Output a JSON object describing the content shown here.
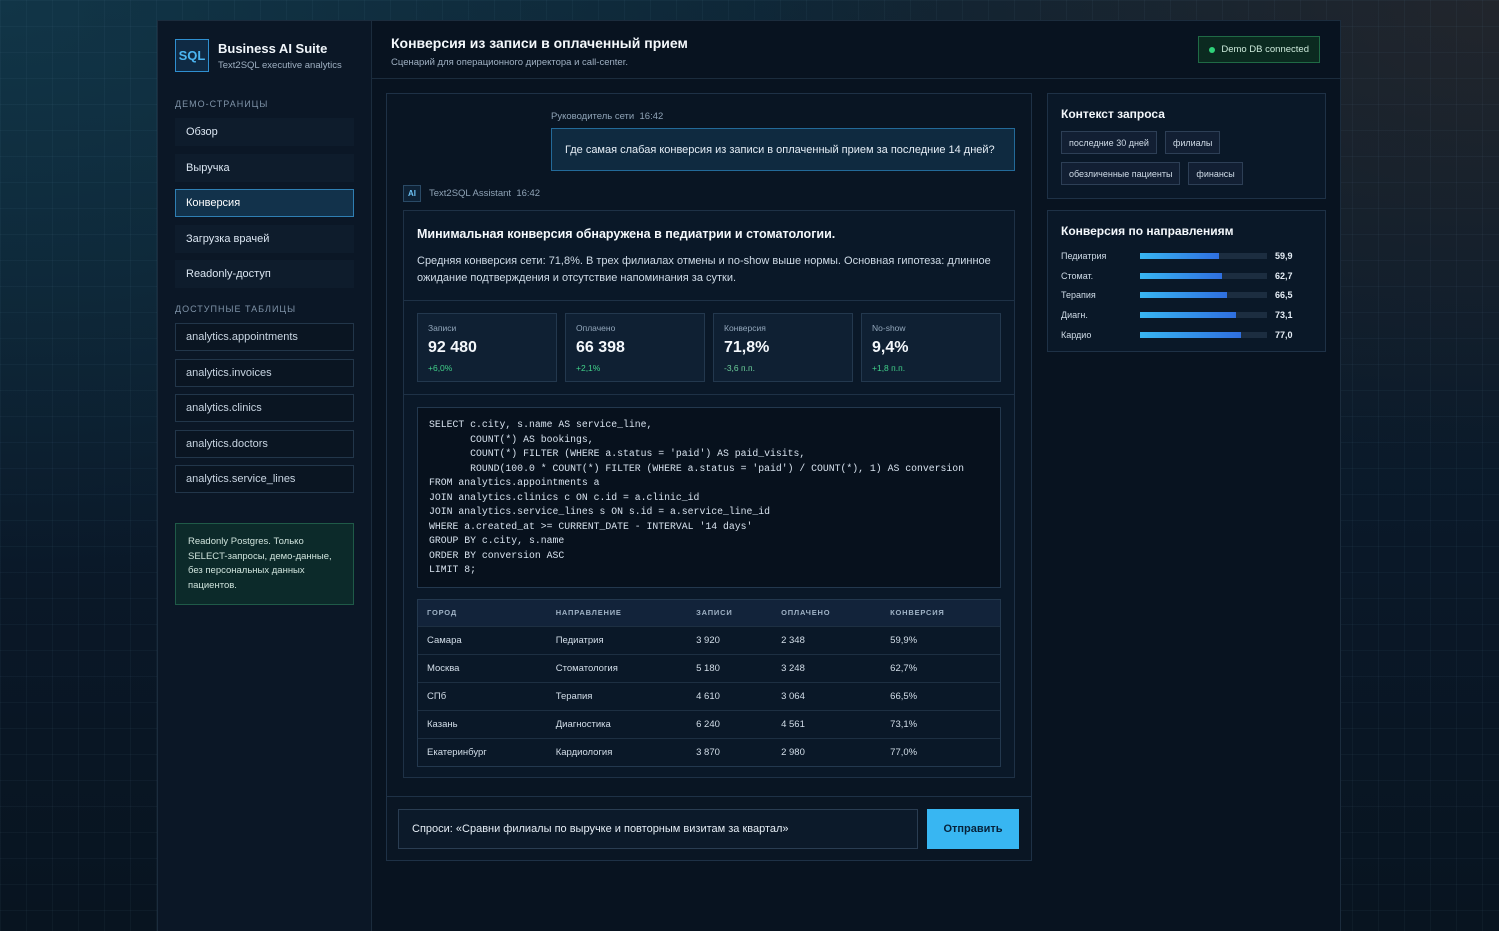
{
  "brand": {
    "logo": "SQL",
    "title": "Business AI Suite",
    "subtitle": "Text2SQL executive analytics"
  },
  "sidebar": {
    "pages_label": "ДЕМО-СТРАНИЦЫ",
    "pages": [
      {
        "label": "Обзор",
        "active": false
      },
      {
        "label": "Выручка",
        "active": false
      },
      {
        "label": "Конверсия",
        "active": true
      },
      {
        "label": "Загрузка врачей",
        "active": false
      },
      {
        "label": "Readonly-доступ",
        "active": false
      }
    ],
    "tables_label": "ДОСТУПНЫЕ ТАБЛИЦЫ",
    "tables": [
      "analytics.appointments",
      "analytics.invoices",
      "analytics.clinics",
      "analytics.doctors",
      "analytics.service_lines"
    ],
    "note": "Readonly Postgres. Только SELECT-запросы, демо-данные, без персональных данных пациентов."
  },
  "header": {
    "title": "Конверсия из записи в оплаченный прием",
    "subtitle": "Сценарий для операционного директора и call-center.",
    "status": "Demo DB connected"
  },
  "chat": {
    "user_author": "Руководитель сети",
    "user_time": "16:42",
    "user_message": "Где самая слабая конверсия из записи в оплаченный прием за последние 14 дней?",
    "ai_badge": "AI",
    "ai_author": "Text2SQL Assistant",
    "ai_time": "16:42",
    "answer_title": "Минимальная конверсия обнаружена в педиатрии и стоматологии.",
    "answer_text": "Средняя конверсия сети: 71,8%. В трех филиалах отмены и no-show выше нормы. Основная гипотеза: длинное ожидание подтверждения и отсутствие напоминания за сутки.",
    "kpis": [
      {
        "label": "Записи",
        "value": "92 480",
        "delta": "+6,0%"
      },
      {
        "label": "Оплачено",
        "value": "66 398",
        "delta": "+2,1%"
      },
      {
        "label": "Конверсия",
        "value": "71,8%",
        "delta": "-3,6 п.п."
      },
      {
        "label": "No-show",
        "value": "9,4%",
        "delta": "+1,8 п.п."
      }
    ],
    "sql": "SELECT c.city, s.name AS service_line,\n       COUNT(*) AS bookings,\n       COUNT(*) FILTER (WHERE a.status = 'paid') AS paid_visits,\n       ROUND(100.0 * COUNT(*) FILTER (WHERE a.status = 'paid') / COUNT(*), 1) AS conversion\nFROM analytics.appointments a\nJOIN analytics.clinics c ON c.id = a.clinic_id\nJOIN analytics.service_lines s ON s.id = a.service_line_id\nWHERE a.created_at >= CURRENT_DATE - INTERVAL '14 days'\nGROUP BY c.city, s.name\nORDER BY conversion ASC\nLIMIT 8;",
    "table": {
      "headers": [
        "ГОРОД",
        "НАПРАВЛЕНИЕ",
        "ЗАПИСИ",
        "ОПЛАЧЕНО",
        "КОНВЕРСИЯ"
      ],
      "rows": [
        [
          "Самара",
          "Педиатрия",
          "3 920",
          "2 348",
          "59,9%"
        ],
        [
          "Москва",
          "Стоматология",
          "5 180",
          "3 248",
          "62,7%"
        ],
        [
          "СПб",
          "Терапия",
          "4 610",
          "3 064",
          "66,5%"
        ],
        [
          "Казань",
          "Диагностика",
          "6 240",
          "4 561",
          "73,1%"
        ],
        [
          "Екатеринбург",
          "Кардиология",
          "3 870",
          "2 980",
          "77,0%"
        ]
      ]
    },
    "input_value": "Спроси: «Сравни филиалы по выручке и повторным визитам за квартал»",
    "send_label": "Отправить"
  },
  "context": {
    "title": "Контекст запроса",
    "chips": [
      "последние 30 дней",
      "филиалы",
      "обезличенные пациенты",
      "финансы"
    ]
  },
  "conversion": {
    "title": "Конверсия по направлениям",
    "items": [
      {
        "label": "Педиатрия",
        "value": "59,9",
        "pct": 59.9
      },
      {
        "label": "Стомат.",
        "value": "62,7",
        "pct": 62.7
      },
      {
        "label": "Терапия",
        "value": "66,5",
        "pct": 66.5
      },
      {
        "label": "Диагн.",
        "value": "73,1",
        "pct": 73.1
      },
      {
        "label": "Кардио",
        "value": "77,0",
        "pct": 77.0
      }
    ]
  }
}
